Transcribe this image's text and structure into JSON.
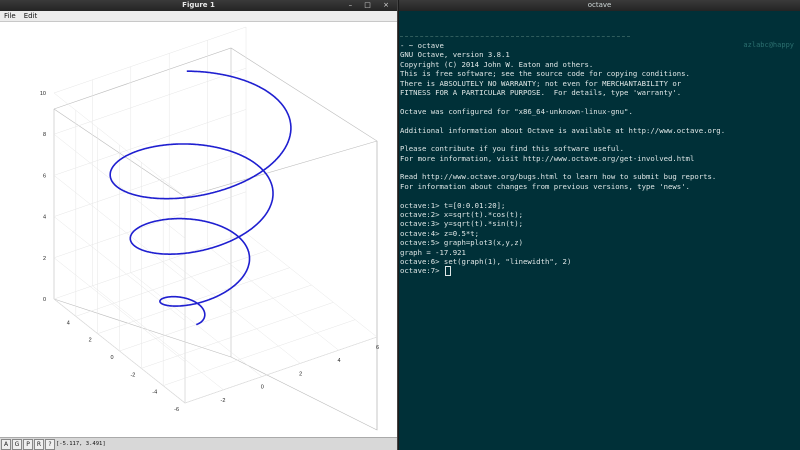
{
  "figure_window": {
    "title": "Figure 1",
    "menu": [
      "File",
      "Edit"
    ],
    "toolbar": [
      "A",
      "G",
      "P",
      "R",
      "?"
    ],
    "coords_readout": "[-5.117, 3.491]"
  },
  "chart_data": {
    "type": "line",
    "plot_kind": "3d",
    "series": [
      {
        "description": "helix",
        "x_expr": "sqrt(t).*cos(t)",
        "y_expr": "sqrt(t).*sin(t)",
        "z_expr": "0.5*t",
        "t_range": [
          0,
          20
        ],
        "t_step": 0.01,
        "color": "#1f1fd0",
        "linewidth": 2
      }
    ],
    "z_ticks": [
      "0",
      "2",
      "4",
      "6",
      "8",
      "10"
    ],
    "y_ticks": [
      "4",
      "2",
      "0",
      "-2",
      "-4",
      "-6"
    ],
    "x_ticks": [
      "-2",
      "0",
      "2",
      "4",
      "6"
    ],
    "xlim": [
      -4,
      6
    ],
    "ylim": [
      -6,
      6
    ],
    "zlim": [
      0,
      10
    ],
    "grid": true
  },
  "terminal": {
    "title": "octave",
    "hostname": "azlabc@happy",
    "lines": [
      "- ~ octave",
      "GNU Octave, version 3.8.1",
      "Copyright (C) 2014 John W. Eaton and others.",
      "This is free software; see the source code for copying conditions.",
      "There is ABSOLUTELY NO WARRANTY; not even for MERCHANTABILITY or",
      "FITNESS FOR A PARTICULAR PURPOSE.  For details, type 'warranty'.",
      "",
      "Octave was configured for \"x86_64-unknown-linux-gnu\".",
      "",
      "Additional information about Octave is available at http://www.octave.org.",
      "",
      "Please contribute if you find this software useful.",
      "For more information, visit http://www.octave.org/get-involved.html",
      "",
      "Read http://www.octave.org/bugs.html to learn how to submit bug reports.",
      "For information about changes from previous versions, type 'news'.",
      "",
      "octave:1> t=[0:0.01:20];",
      "octave:2> x=sqrt(t).*cos(t);",
      "octave:3> y=sqrt(t).*sin(t);",
      "octave:4> z=0.5*t;",
      "octave:5> graph=plot3(x,y,z)",
      "graph = -17.921",
      "octave:6> set(graph(1), \"linewidth\", 2)"
    ],
    "prompt": "octave:7> "
  }
}
